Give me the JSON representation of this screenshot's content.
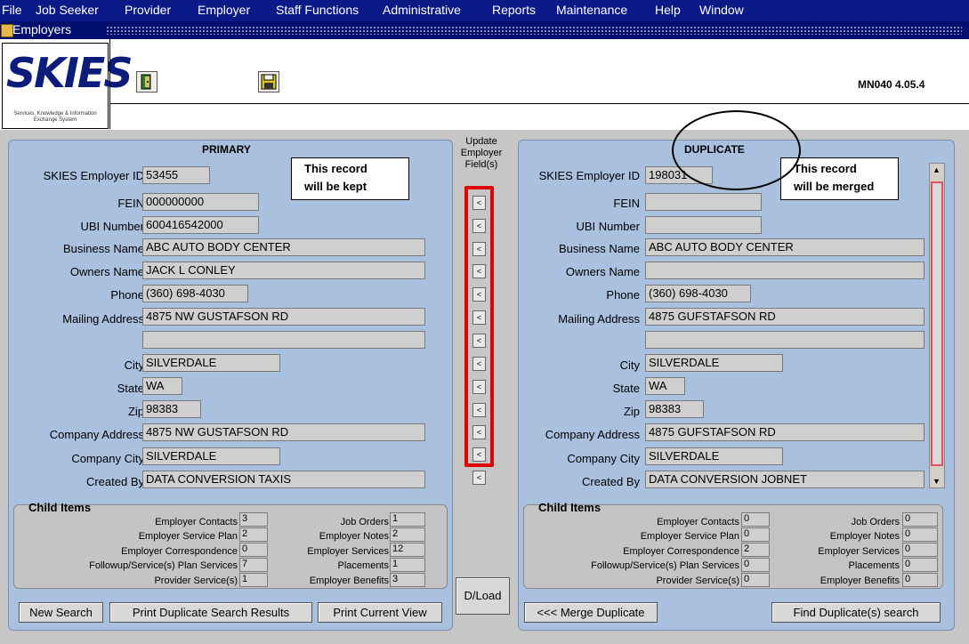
{
  "menu": [
    "File",
    "Job Seeker",
    "Provider",
    "Employer",
    "Staff Functions",
    "Administrative",
    "Reports",
    "Maintenance",
    "Help",
    "Window"
  ],
  "window_title": "Employers",
  "logo": {
    "text": "SKIES",
    "subtitle": "Services, Knowledge & Information Exchange System"
  },
  "form_code": "MN040 4.05.4",
  "primary": {
    "title": "PRIMARY",
    "note_line1": "This record",
    "note_line2": "will be kept",
    "labels": [
      "SKIES Employer ID",
      "FEIN",
      "UBI Number",
      "Business Name",
      "Owners Name",
      "Phone",
      "Mailing Address",
      "City",
      "State",
      "Zip",
      "Company Address",
      "Company City",
      "Created By"
    ],
    "employer_id": "53455",
    "fein": "000000000",
    "ubi": "600416542000",
    "business_name": "ABC AUTO BODY CENTER",
    "owners_name": "JACK L CONLEY",
    "phone": "(360) 698-4030",
    "mailing1": "4875 NW GUSTAFSON RD",
    "mailing2": "",
    "city": "SILVERDALE",
    "state": "WA",
    "zip": "98383",
    "company_address": "4875 NW GUSTAFSON RD",
    "company_city": "SILVERDALE",
    "created_by": "DATA CONVERSION TAXIS",
    "child_title": "Child Items",
    "child_left": [
      {
        "label": "Employer Contacts",
        "value": "3"
      },
      {
        "label": "Employer Service Plan",
        "value": "2"
      },
      {
        "label": "Employer Correspondence",
        "value": "0"
      },
      {
        "label": "Followup/Service(s) Plan Services",
        "value": "7"
      },
      {
        "label": "Provider Service(s)",
        "value": "1"
      }
    ],
    "child_right": [
      {
        "label": "Job Orders",
        "value": "1"
      },
      {
        "label": "Employer Notes",
        "value": "2"
      },
      {
        "label": "Employer Services",
        "value": "12"
      },
      {
        "label": "Placements",
        "value": "1"
      },
      {
        "label": "Employer Benefits",
        "value": "3"
      }
    ]
  },
  "duplicate": {
    "title": "DUPLICATE",
    "note_line1": "This record",
    "note_line2": "will be merged",
    "employer_id": "198031",
    "fein": "",
    "ubi": "",
    "business_name": "ABC AUTO BODY CENTER",
    "owners_name": "",
    "phone": "(360) 698-4030",
    "mailing1": "4875 GUFSTAFSON RD",
    "mailing2": "",
    "city": "SILVERDALE",
    "state": "WA",
    "zip": "98383",
    "company_address": "4875 GUFSTAFSON RD",
    "company_city": "SILVERDALE",
    "created_by": "DATA CONVERSION JOBNET",
    "child_title": "Child Items",
    "child_left": [
      {
        "label": "Employer Contacts",
        "value": "0"
      },
      {
        "label": "Employer Service Plan",
        "value": "0"
      },
      {
        "label": "Employer Correspondence",
        "value": "2"
      },
      {
        "label": "Followup/Service(s) Plan Services",
        "value": "0"
      },
      {
        "label": "Provider Service(s)",
        "value": "0"
      }
    ],
    "child_right": [
      {
        "label": "Job Orders",
        "value": "0"
      },
      {
        "label": "Employer Notes",
        "value": "0"
      },
      {
        "label": "Employer Services",
        "value": "0"
      },
      {
        "label": "Placements",
        "value": "0"
      },
      {
        "label": "Employer Benefits",
        "value": "0"
      }
    ]
  },
  "middle": {
    "header_line1": "Update",
    "header_line2": "Employer",
    "header_line3": "Field(s)",
    "arrow": "<",
    "dload": "D/Load"
  },
  "buttons": {
    "new_search": "New Search",
    "print_dup": "Print Duplicate Search Results",
    "print_view": "Print Current View",
    "merge": "<<< Merge Duplicate",
    "find_dup": "Find Duplicate(s) search"
  },
  "colors": {
    "menubar": "#0a1a86",
    "panel": "#a9c0de",
    "highlight": "#e00000"
  }
}
